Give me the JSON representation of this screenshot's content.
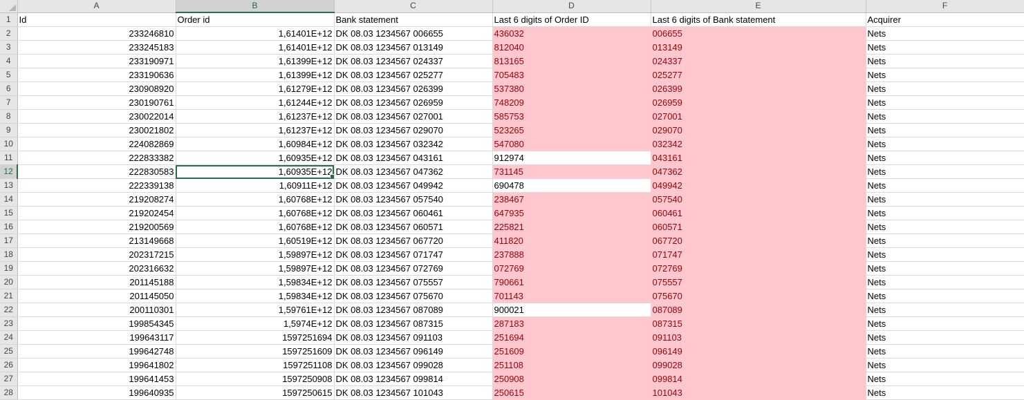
{
  "columns": [
    "A",
    "B",
    "C",
    "D",
    "E",
    "F"
  ],
  "header_row": {
    "num": "1",
    "cells": [
      "Id",
      "Order id",
      "Bank statement",
      "Last 6 digits of Order ID",
      "Last 6 digits of Bank statement",
      "Acquirer"
    ]
  },
  "rows": [
    {
      "num": "2",
      "id": "233246810",
      "order": "1,61401E+12",
      "bank": "DK 08.03 1234567 006655",
      "last_order": "436032",
      "last_bank": "006655",
      "acq": "Nets"
    },
    {
      "num": "3",
      "id": "233245183",
      "order": "1,61401E+12",
      "bank": "DK 08.03 1234567 013149",
      "last_order": "812040",
      "last_bank": "013149",
      "acq": "Nets"
    },
    {
      "num": "4",
      "id": "233190971",
      "order": "1,61399E+12",
      "bank": "DK 08.03 1234567 024337",
      "last_order": "813165",
      "last_bank": "024337",
      "acq": "Nets"
    },
    {
      "num": "5",
      "id": "233190636",
      "order": "1,61399E+12",
      "bank": "DK 08.03 1234567 025277",
      "last_order": "705483",
      "last_bank": "025277",
      "acq": "Nets"
    },
    {
      "num": "6",
      "id": "230908920",
      "order": "1,61279E+12",
      "bank": "DK 08.03 1234567 026399",
      "last_order": "537380",
      "last_bank": "026399",
      "acq": "Nets"
    },
    {
      "num": "7",
      "id": "230190761",
      "order": "1,61244E+12",
      "bank": "DK 08.03 1234567 026959",
      "last_order": "748209",
      "last_bank": "026959",
      "acq": "Nets"
    },
    {
      "num": "8",
      "id": "230022014",
      "order": "1,61237E+12",
      "bank": "DK 08.03 1234567 027001",
      "last_order": "585753",
      "last_bank": "027001",
      "acq": "Nets"
    },
    {
      "num": "9",
      "id": "230021802",
      "order": "1,61237E+12",
      "bank": "DK 08.03 1234567 029070",
      "last_order": "523265",
      "last_bank": "029070",
      "acq": "Nets"
    },
    {
      "num": "10",
      "id": "224082869",
      "order": "1,60984E+12",
      "bank": "DK 08.03 1234567 032342",
      "last_order": "547080",
      "last_bank": "032342",
      "acq": "Nets"
    },
    {
      "num": "11",
      "id": "222833382",
      "order": "1,60935E+12",
      "bank": "DK 08.03 1234567 043161",
      "last_order": "912974",
      "last_bank": "043161",
      "acq": "Nets"
    },
    {
      "num": "12",
      "id": "222830583",
      "order": "1,60935E+12",
      "bank": "DK 08.03 1234567 047362",
      "last_order": "731145",
      "last_bank": "047362",
      "acq": "Nets"
    },
    {
      "num": "13",
      "id": "222339138",
      "order": "1,60911E+12",
      "bank": "DK 08.03 1234567 049942",
      "last_order": "690478",
      "last_bank": "049942",
      "acq": "Nets"
    },
    {
      "num": "14",
      "id": "219208274",
      "order": "1,60768E+12",
      "bank": "DK 08.03 1234567 057540",
      "last_order": "238467",
      "last_bank": "057540",
      "acq": "Nets"
    },
    {
      "num": "15",
      "id": "219202454",
      "order": "1,60768E+12",
      "bank": "DK 08.03 1234567 060461",
      "last_order": "647935",
      "last_bank": "060461",
      "acq": "Nets"
    },
    {
      "num": "16",
      "id": "219200569",
      "order": "1,60768E+12",
      "bank": "DK 08.03 1234567 060571",
      "last_order": "225821",
      "last_bank": "060571",
      "acq": "Nets"
    },
    {
      "num": "17",
      "id": "213149668",
      "order": "1,60519E+12",
      "bank": "DK 08.03 1234567 067720",
      "last_order": "411820",
      "last_bank": "067720",
      "acq": "Nets"
    },
    {
      "num": "18",
      "id": "202317215",
      "order": "1,59897E+12",
      "bank": "DK 08.03 1234567 071747",
      "last_order": "237888",
      "last_bank": "071747",
      "acq": "Nets"
    },
    {
      "num": "19",
      "id": "202316632",
      "order": "1,59897E+12",
      "bank": "DK 08.03 1234567 072769",
      "last_order": "072769",
      "last_bank": "072769",
      "acq": "Nets"
    },
    {
      "num": "20",
      "id": "201145188",
      "order": "1,59834E+12",
      "bank": "DK 08.03 1234567 075557",
      "last_order": "790661",
      "last_bank": "075557",
      "acq": "Nets"
    },
    {
      "num": "21",
      "id": "201145050",
      "order": "1,59834E+12",
      "bank": "DK 08.03 1234567 075670",
      "last_order": "701143",
      "last_bank": "075670",
      "acq": "Nets"
    },
    {
      "num": "22",
      "id": "200110301",
      "order": "1,59761E+12",
      "bank": "DK 08.03 1234567 087089",
      "last_order": "900021",
      "last_bank": "087089",
      "acq": "Nets"
    },
    {
      "num": "23",
      "id": "199854345",
      "order": "1,5974E+12",
      "bank": "DK 08.03 1234567 087315",
      "last_order": "287183",
      "last_bank": "087315",
      "acq": "Nets"
    },
    {
      "num": "24",
      "id": "199643117",
      "order": "1597251694",
      "bank": "DK 08.03 1234567 091103",
      "last_order": "251694",
      "last_bank": "091103",
      "acq": "Nets"
    },
    {
      "num": "25",
      "id": "199642748",
      "order": "1597251609",
      "bank": "DK 08.03 1234567 096149",
      "last_order": "251609",
      "last_bank": "096149",
      "acq": "Nets"
    },
    {
      "num": "26",
      "id": "199641802",
      "order": "1597251108",
      "bank": "DK 08.03 1234567 099028",
      "last_order": "251108",
      "last_bank": "099028",
      "acq": "Nets"
    },
    {
      "num": "27",
      "id": "199641453",
      "order": "1597250908",
      "bank": "DK 08.03 1234567 099814",
      "last_order": "250908",
      "last_bank": "099814",
      "acq": "Nets"
    },
    {
      "num": "28",
      "id": "199640935",
      "order": "1597250615",
      "bank": "DK 08.03 1234567 101043",
      "last_order": "250615",
      "last_bank": "101043",
      "acq": "Nets"
    }
  ],
  "plain_order_rows": [
    "11",
    "13",
    "22"
  ],
  "active_row": "12",
  "colors": {
    "highlight_fill": "#ffc7ce",
    "highlight_text": "#9c0006",
    "selection": "#217346"
  }
}
